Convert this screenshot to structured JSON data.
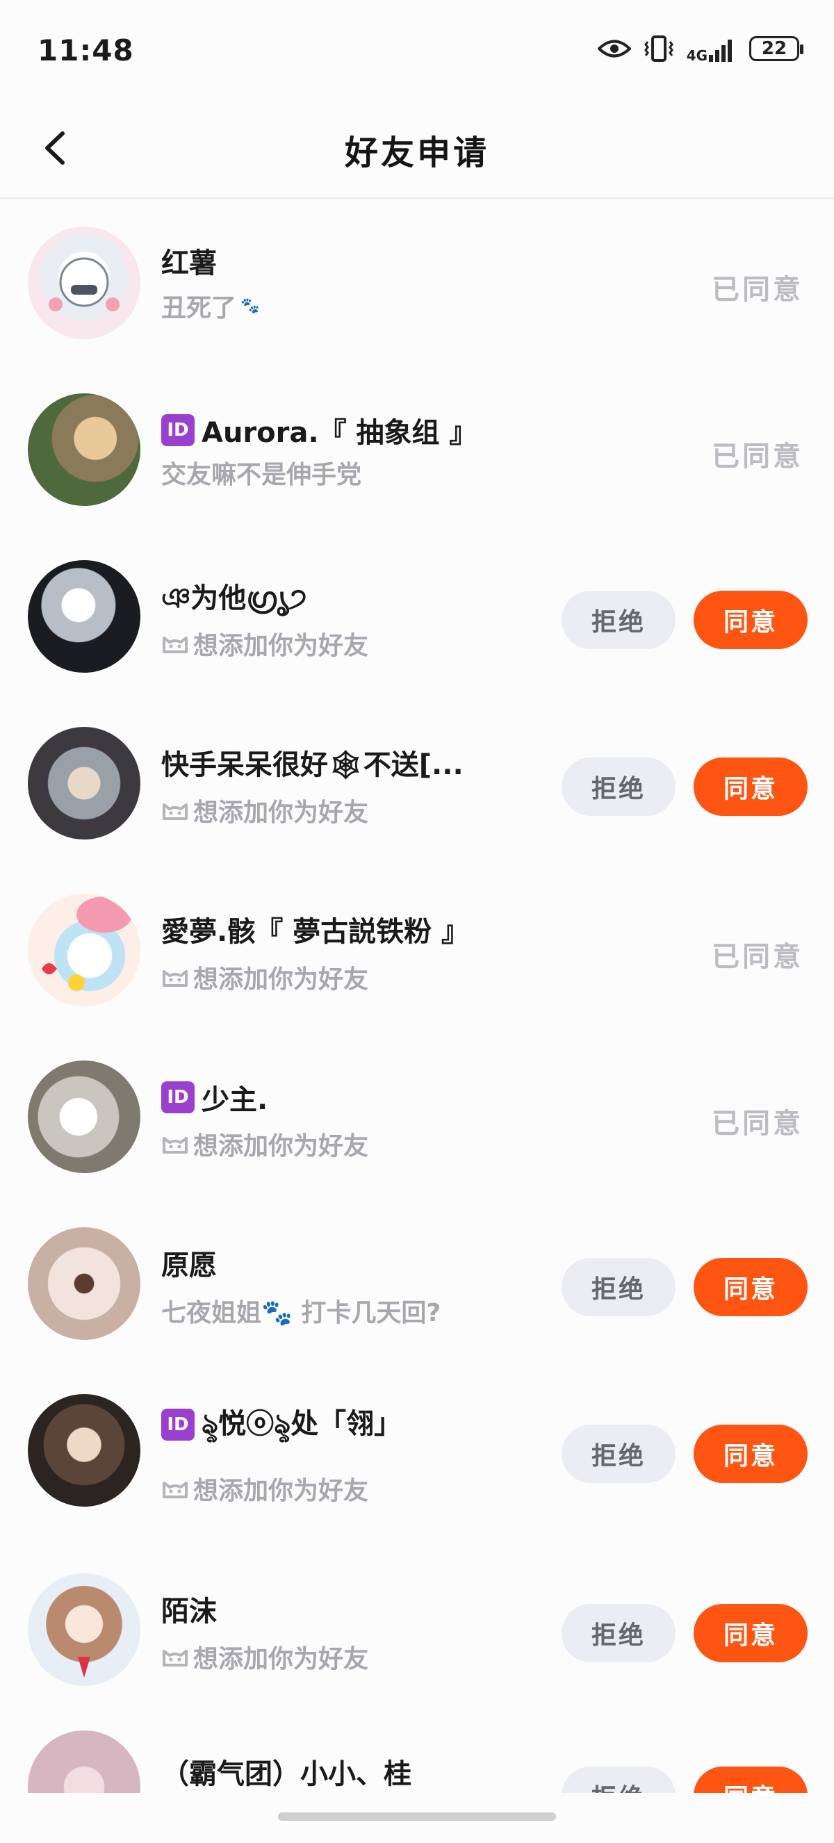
{
  "status_bar": {
    "time": "11:48",
    "signal_label": "4G",
    "battery": "22"
  },
  "header": {
    "title": "好友申请"
  },
  "buttons": {
    "reject": "拒绝",
    "accept": "同意"
  },
  "requests": [
    {
      "name": "红薯",
      "message": "丑死了",
      "message_suffix": "🐾",
      "status": "已同意",
      "verified": false,
      "has_paw_icon": false
    },
    {
      "name": "Aurora.『 抽象组 』",
      "message": "交友嘛不是伸手党",
      "message_suffix": "",
      "status": "已同意",
      "verified": true,
      "has_paw_icon": false
    },
    {
      "name": "ঞ为他ഗ്രൃ੭",
      "message": "想添加你为好友",
      "message_suffix": "",
      "status": "pending",
      "verified": false,
      "has_paw_icon": true
    },
    {
      "name": "快手呆呆很好🕸不送[...",
      "message": "想添加你为好友",
      "message_suffix": "",
      "status": "pending",
      "verified": false,
      "has_paw_icon": true
    },
    {
      "name": "愛夢.骸『 夢古説铁粉 』",
      "message": "想添加你为好友",
      "message_suffix": "",
      "status": "已同意",
      "verified": false,
      "has_paw_icon": true
    },
    {
      "name": "少主.",
      "message": "想添加你为好友",
      "message_suffix": "",
      "status": "已同意",
      "verified": true,
      "has_paw_icon": true
    },
    {
      "name": "原愿",
      "message": "七夜姐姐🐾 打卡几天回?",
      "message_suffix": "",
      "status": "pending",
      "verified": false,
      "has_paw_icon": false
    },
    {
      "name": "ৡ悦ⓞৡ处「翎」",
      "message": "想添加你为好友",
      "message_suffix": "",
      "status": "pending",
      "verified": true,
      "has_paw_icon": true
    },
    {
      "name": "陌沫",
      "message": "想添加你为好友",
      "message_suffix": "",
      "status": "pending",
      "verified": false,
      "has_paw_icon": true
    },
    {
      "name": "（霸气团）小小、桂",
      "message": "",
      "message_suffix": "",
      "status": "pending",
      "verified": false,
      "has_paw_icon": false
    }
  ],
  "colors": {
    "accent": "#ff5512",
    "reject_bg": "#ecedf3",
    "done_text": "#bcbcc2",
    "verified_badge": "#9b3fcf"
  }
}
